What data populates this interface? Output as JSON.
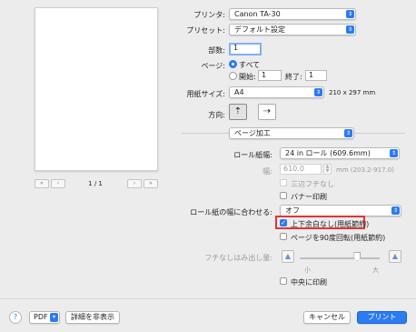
{
  "preview": {
    "page_indicator": "1 / 1"
  },
  "printer": {
    "label": "プリンタ:",
    "value": "Canon TA-30"
  },
  "preset": {
    "label": "プリセット:",
    "value": "デフォルト設定"
  },
  "copies": {
    "label": "部数:",
    "value": "1"
  },
  "pages": {
    "label": "ページ:",
    "all_label": "すべて",
    "from_label": "開始:",
    "from_value": "1",
    "to_label": "終了:",
    "to_value": "1"
  },
  "paper_size": {
    "label": "用紙サイズ:",
    "value": "A4",
    "dimensions": "210 x 297 mm"
  },
  "orientation": {
    "label": "方向:"
  },
  "panel": {
    "value": "ページ加工"
  },
  "roll_paper": {
    "label": "ロール紙幅:",
    "value": "24 in ロール (609.6mm)"
  },
  "width": {
    "label": "幅:",
    "value": "610.0",
    "unit": "mm (203.2-917.0)"
  },
  "options": {
    "three_side_borderless": "三辺フチなし",
    "banner_print": "バナー印刷"
  },
  "fit_roll": {
    "label": "ロール紙の幅に合わせる:",
    "value": "オフ"
  },
  "checks": {
    "no_top_bottom_margin": "上下余白なし(用紙節約)",
    "rotate_90": "ページを90度回転(用紙節約)"
  },
  "borderless_extension": {
    "label": "フチなしはみ出し量:",
    "small": "小",
    "large": "大",
    "value": 0.72
  },
  "center_print": "中央に印刷",
  "footer": {
    "help": "?",
    "pdf": "PDF",
    "hide_details": "詳細を非表示",
    "cancel": "キャンセル",
    "print": "プリント"
  }
}
